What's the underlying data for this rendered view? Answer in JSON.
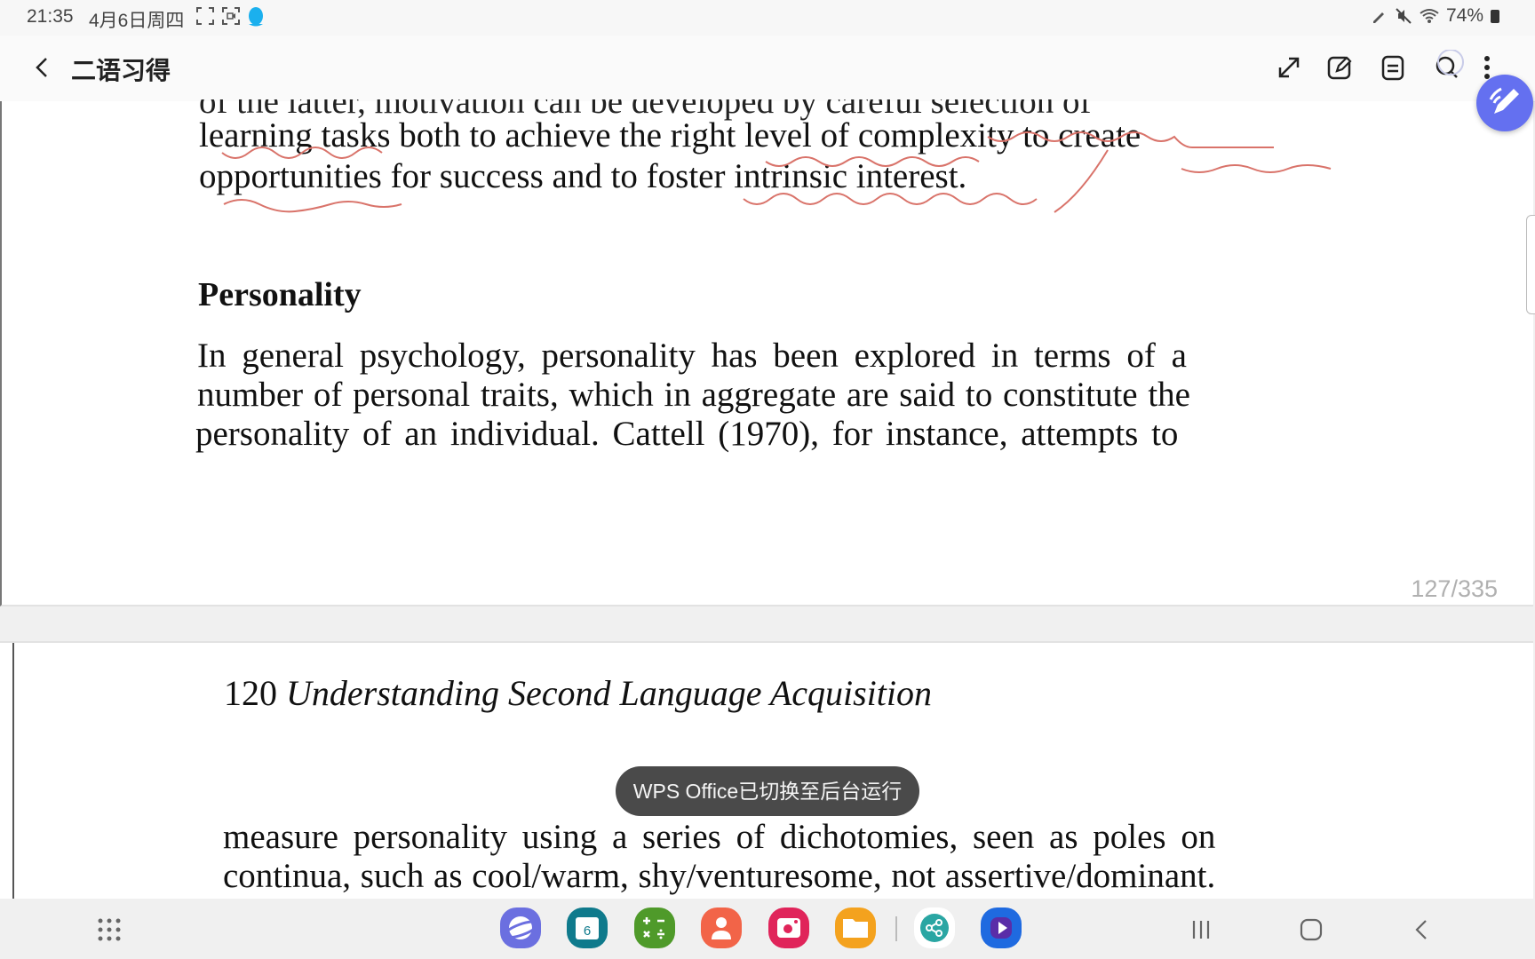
{
  "status_bar": {
    "time": "21:35",
    "date": "4月6日周四",
    "left_icons": [
      "screenshot-icon",
      "screen-record-icon",
      "qq-icon"
    ],
    "right_icons": [
      "pen-icon",
      "mute-icon",
      "wifi-icon",
      "battery-icon"
    ],
    "battery": "74%"
  },
  "app_bar": {
    "title": "二语习得",
    "actions": [
      "expand-icon",
      "edit-icon",
      "notes-icon",
      "search-icon",
      "more-icon"
    ]
  },
  "page1": {
    "partial_line": "of the latter, motivation can be developed by careful selection of",
    "lines_before": [
      "learning tasks both to achieve the right level of complexity to create",
      "opportunities for success and to foster intrinsic interest."
    ],
    "heading": "Personality",
    "paragraph": [
      "In general psychology, personality has been explored in terms of a",
      "number of personal traits, which in aggregate are said to constitute the",
      "personality of an individual. Cattell (1970), for instance, attempts to"
    ],
    "page_indicator": "127/335",
    "annotation_color": "#d9736a"
  },
  "page2": {
    "running_head_number": "120",
    "running_head_title": "Understanding Second Language Acquisition",
    "lines": [
      "measure personality using a series of dichotomies, seen as poles on",
      "continua, such as cool/warm, shy/venturesome, not assertive/dominant."
    ]
  },
  "toast": "WPS Office已切换至后台运行",
  "dock": {
    "apps": [
      {
        "name": "internet",
        "color": "#6b6fe0"
      },
      {
        "name": "calendar",
        "label": "6",
        "color": "#0f7a8c"
      },
      {
        "name": "calculator",
        "label": "+−×÷",
        "color": "#4f9a2a"
      },
      {
        "name": "contacts",
        "color": "#f26448"
      },
      {
        "name": "camera",
        "color": "#e0245a"
      },
      {
        "name": "my-files",
        "color": "#f4a21e"
      },
      {
        "name": "share",
        "color": "#2aa6a3"
      },
      {
        "name": "video",
        "color": "#1f6ae0"
      }
    ],
    "nav": [
      "recents-button",
      "home-button",
      "back-button"
    ]
  }
}
